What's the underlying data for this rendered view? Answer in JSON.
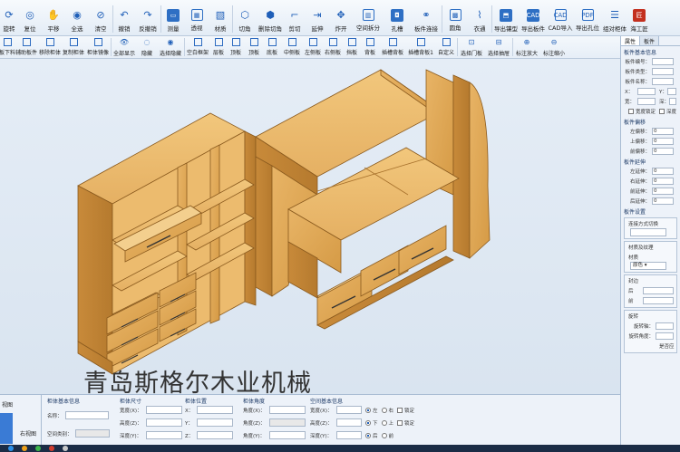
{
  "toolbar1": {
    "items": [
      "旋转",
      "复位",
      "平移",
      "全选",
      "清空",
      "撤销",
      "反撤销",
      "测量",
      "透视",
      "材质",
      "切角",
      "删除切角",
      "剪切",
      "延伸",
      "炸开",
      "空间拆分",
      "孔槽",
      "板件连接",
      "圆角",
      "衣通",
      "导出镶型",
      "导出板件",
      "CAD导入",
      "导出孔位",
      "组对柜体",
      "海工匠"
    ],
    "cad_badge": "CAD",
    "pdf_badge": "PDF"
  },
  "toolbar2": {
    "items": [
      "添加板下料",
      "辅助板件",
      "移除柜体",
      "复制柜体",
      "柜体镜像",
      "全部显示",
      "隐藏",
      "选择隐藏",
      "空白框架",
      "层板",
      "顶板",
      "顶板",
      "底板",
      "中侧板",
      "左侧板",
      "右侧板",
      "挡板",
      "背板",
      "插槽背板",
      "插槽背板1",
      "自定义",
      "选择门板",
      "选择抽屉",
      "标注放大",
      "标注缩小"
    ]
  },
  "viewport": {
    "watermark": "青岛斯格尔木业机械"
  },
  "right_panel": {
    "tabs": [
      "属性",
      "板件"
    ],
    "group_basic": "板件基本信息",
    "fields_basic": [
      "板件编号：",
      "板件类型：",
      "板件名称："
    ],
    "xy_labels": [
      "X：",
      "Y："
    ],
    "wd_labels": [
      "宽：",
      "深："
    ],
    "checks": [
      "宽度锁定",
      "深度"
    ],
    "group_offset": "板件偏移",
    "offset_fields": [
      "左偏移：",
      "上偏移：",
      "前偏移："
    ],
    "offset_value": "0",
    "group_extend": "板件延伸",
    "extend_fields": [
      "左延伸：",
      "右延伸：",
      "前延伸：",
      "后延伸："
    ],
    "extend_value": "0",
    "group_settings": "板件设置",
    "connect_label": "连接方式切换",
    "group_texture": "材质及纹理",
    "material_label": "材质",
    "material_value": "原色",
    "group_seal": "封边",
    "seal_fields": [
      "后",
      "前"
    ],
    "group_rotate": "旋转",
    "rotate_fields": [
      "旋转轴：",
      "旋转角度："
    ],
    "apply_label": "是否应"
  },
  "bottom_panel": {
    "views": [
      "视图",
      "右视图"
    ],
    "group_cabinet": "柜体基本信息",
    "name_label": "名称：",
    "space_label": "空间类别：",
    "group_size": "柜体尺寸",
    "size_fields": [
      "宽度(X)：",
      "高度(Z)：",
      "深度(Y)："
    ],
    "group_position": "柜体位置",
    "position_fields": [
      "X：",
      "Y：",
      "Z："
    ],
    "group_angle": "柜体角度",
    "angle_fields": [
      "角度(X)：",
      "角度(Z)：",
      "角度(Y)："
    ],
    "group_space": "空间基本信息",
    "space_fields": [
      "宽度(X)：",
      "高度(Z)：",
      "深度(Y)："
    ],
    "radio_rows": [
      [
        "左",
        "右",
        "锁定"
      ],
      [
        "下",
        "上",
        "锁定"
      ],
      [
        "后",
        "前"
      ]
    ]
  }
}
